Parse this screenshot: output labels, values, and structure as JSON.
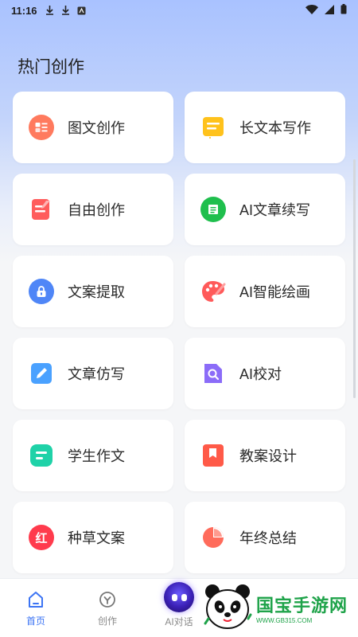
{
  "status": {
    "time": "11:16"
  },
  "section": {
    "title": "热门创作"
  },
  "cards": [
    {
      "label": "图文创作",
      "icon": "image-text-icon",
      "color": "#ff6f5b"
    },
    {
      "label": "长文本写作",
      "icon": "document-icon",
      "color": "#ffc21c"
    },
    {
      "label": "自由创作",
      "icon": "edit-note-icon",
      "color": "#ff5c5c"
    },
    {
      "label": "AI文章续写",
      "icon": "scroll-icon",
      "color": "#1fbf4d"
    },
    {
      "label": "文案提取",
      "icon": "lock-extract-icon",
      "color": "#4f86f7"
    },
    {
      "label": "AI智能绘画",
      "icon": "palette-icon",
      "color": "#ff5a5a"
    },
    {
      "label": "文章仿写",
      "icon": "pencil-icon",
      "color": "#4aa1ff"
    },
    {
      "label": "AI校对",
      "icon": "search-doc-icon",
      "color": "#8b6cf8"
    },
    {
      "label": "学生作文",
      "icon": "notebook-icon",
      "color": "#1fd2a8"
    },
    {
      "label": "教案设计",
      "icon": "bookmark-icon",
      "color": "#ff5a48"
    },
    {
      "label": "种草文案",
      "icon": "red-badge-icon",
      "color": "#ff3b4d",
      "glyph": "红"
    },
    {
      "label": "年终总结",
      "icon": "pie-chart-icon",
      "color": "#ff6b5b"
    }
  ],
  "tabs": [
    {
      "label": "首页",
      "icon": "home-icon",
      "active": true
    },
    {
      "label": "创作",
      "icon": "create-icon",
      "active": false
    },
    {
      "label": "AI对话",
      "icon": "ai-robot-icon",
      "active": false
    }
  ],
  "watermark": {
    "text": "国宝手游网",
    "url": "WWW.GB315.COM"
  }
}
